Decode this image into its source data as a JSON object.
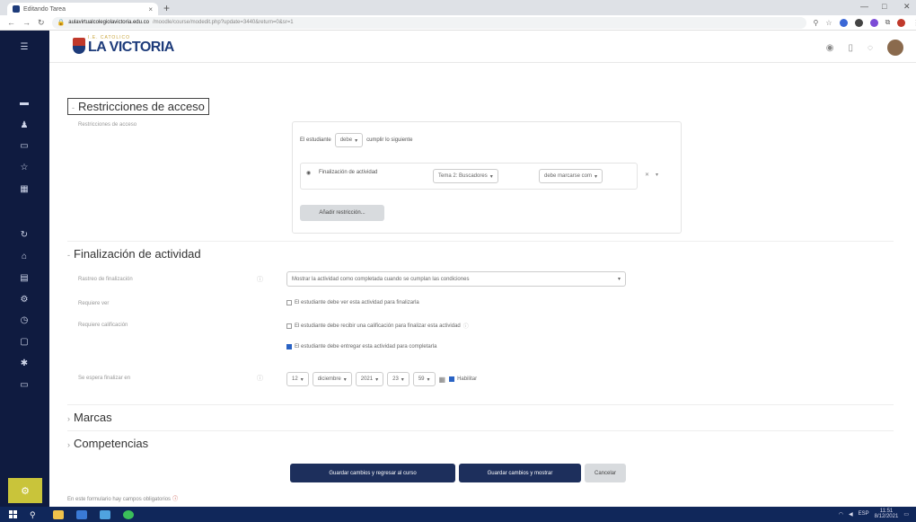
{
  "browser": {
    "tab_title": "Editando Tarea",
    "url_host": "aulavirtualcolegiolavictoria.edu.co",
    "url_path": "/moodle/course/modedit.php?update=3440&return=0&sr=1",
    "new_tab_symbol": "+",
    "tab_close_symbol": "×"
  },
  "header": {
    "logo_small": "I.E. CATOLICO",
    "logo_big": "LA VICTORIA"
  },
  "restrictions": {
    "section_title": "Restricciones de acceso",
    "label": "Restricciones de acceso",
    "student_prefix": "El estudiante",
    "must_select": "debe",
    "suffix": "cumplir lo siguiente",
    "condition_type": "Finalización de actividad",
    "activity_select": "Tema 2: Buscadores",
    "completion_select": "debe marcarse com",
    "add_button": "Añadir restricción..."
  },
  "completion": {
    "section_title": "Finalización de actividad",
    "tracking_label": "Rastreo de finalización",
    "tracking_value": "Mostrar la actividad como completada cuando se cumplan las condiciones",
    "view_label": "Requiere ver",
    "view_text": "El estudiante debe ver esta actividad para finalizarla",
    "grade_label": "Requiere calificación",
    "grade_text": "El estudiante debe recibir una calificación para finalizar esta actividad",
    "submit_text": "El estudiante debe entregar esta actividad para completarla",
    "expected_label": "Se espera finalizar en",
    "day": "12",
    "month": "diciembre",
    "year": "2021",
    "hour": "23",
    "minute": "59",
    "enable_label": "Habilitar"
  },
  "sections": {
    "tags": "Marcas",
    "competencies": "Competencias"
  },
  "buttons": {
    "save_return": "Guardar cambios y regresar al curso",
    "save_show": "Guardar cambios y mostrar",
    "cancel": "Cancelar"
  },
  "footer_note": "En este formulario hay campos obligatorios",
  "taskbar": {
    "lang": "ESP",
    "time": "11:51",
    "date": "8/12/2021"
  },
  "colors": {
    "nav_bg": "#0f1b40",
    "primary_button": "#1d2f5c",
    "checkbox_on": "#2a63c4"
  }
}
